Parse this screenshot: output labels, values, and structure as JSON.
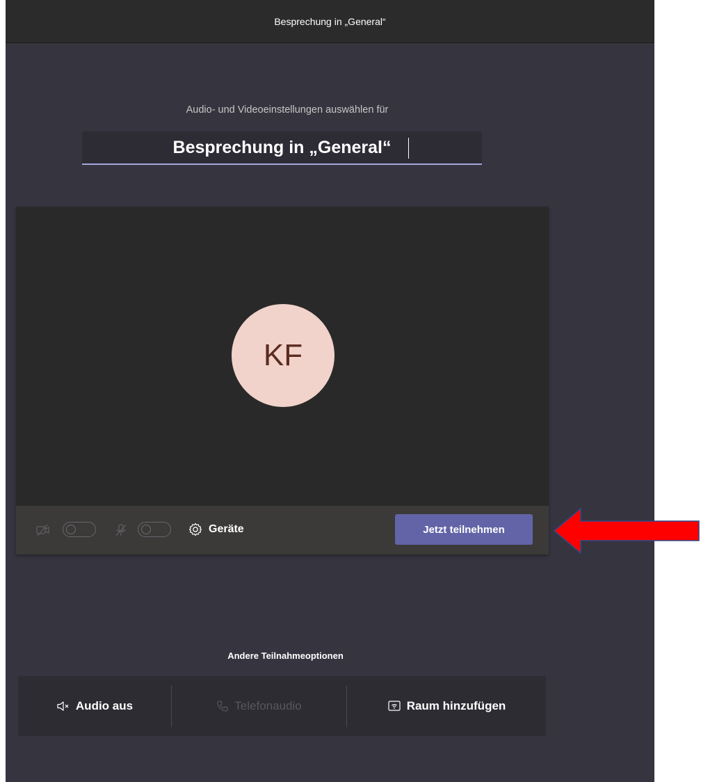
{
  "window": {
    "title": "Besprechung in „General“"
  },
  "setup": {
    "subtitle": "Audio- und Videoeinstellungen auswählen für",
    "meeting_name": "Besprechung in „General“"
  },
  "preview": {
    "avatar_initials": "KF",
    "camera_enabled": false,
    "microphone_enabled": false,
    "devices_label": "Geräte",
    "join_label": "Jetzt teilnehmen"
  },
  "other_options": {
    "title": "Andere Teilnahmeoptionen",
    "items": [
      {
        "label": "Audio aus",
        "icon": "speaker-off-icon",
        "enabled": true
      },
      {
        "label": "Telefonaudio",
        "icon": "phone-icon",
        "enabled": false
      },
      {
        "label": "Raum hinzufügen",
        "icon": "room-cast-icon",
        "enabled": true
      }
    ]
  },
  "colors": {
    "accent": "#6264a7",
    "background": "#36343f",
    "avatar_bg": "#f1d3cb",
    "annotation_arrow": "#ff0000"
  }
}
